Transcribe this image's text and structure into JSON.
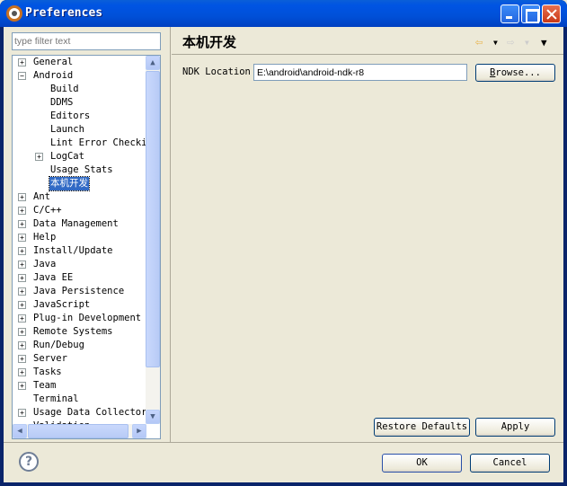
{
  "window": {
    "title": "Preferences"
  },
  "filter": {
    "placeholder": "type filter text"
  },
  "tree": [
    {
      "label": "General",
      "level": 0,
      "expander": "+"
    },
    {
      "label": "Android",
      "level": 0,
      "expander": "-"
    },
    {
      "label": "Build",
      "level": 1,
      "expander": ""
    },
    {
      "label": "DDMS",
      "level": 1,
      "expander": ""
    },
    {
      "label": "Editors",
      "level": 1,
      "expander": ""
    },
    {
      "label": "Launch",
      "level": 1,
      "expander": ""
    },
    {
      "label": "Lint Error Checkir",
      "level": 1,
      "expander": ""
    },
    {
      "label": "LogCat",
      "level": 1,
      "expander": "+"
    },
    {
      "label": "Usage Stats",
      "level": 1,
      "expander": ""
    },
    {
      "label": "本机开发",
      "level": 1,
      "expander": "",
      "selected": true
    },
    {
      "label": "Ant",
      "level": 0,
      "expander": "+"
    },
    {
      "label": "C/C++",
      "level": 0,
      "expander": "+"
    },
    {
      "label": "Data Management",
      "level": 0,
      "expander": "+"
    },
    {
      "label": "Help",
      "level": 0,
      "expander": "+"
    },
    {
      "label": "Install/Update",
      "level": 0,
      "expander": "+"
    },
    {
      "label": "Java",
      "level": 0,
      "expander": "+"
    },
    {
      "label": "Java EE",
      "level": 0,
      "expander": "+"
    },
    {
      "label": "Java Persistence",
      "level": 0,
      "expander": "+"
    },
    {
      "label": "JavaScript",
      "level": 0,
      "expander": "+"
    },
    {
      "label": "Plug-in Development",
      "level": 0,
      "expander": "+"
    },
    {
      "label": "Remote Systems",
      "level": 0,
      "expander": "+"
    },
    {
      "label": "Run/Debug",
      "level": 0,
      "expander": "+"
    },
    {
      "label": "Server",
      "level": 0,
      "expander": "+"
    },
    {
      "label": "Tasks",
      "level": 0,
      "expander": "+"
    },
    {
      "label": "Team",
      "level": 0,
      "expander": "+"
    },
    {
      "label": "Terminal",
      "level": 0,
      "expander": ""
    },
    {
      "label": "Usage Data Collector",
      "level": 0,
      "expander": "+"
    },
    {
      "label": "Validation",
      "level": 0,
      "expander": ""
    }
  ],
  "page": {
    "title": "本机开发",
    "ndk_label": "NDK Location",
    "ndk_value": "E:\\android\\android-ndk-r8",
    "browse_label": "Browse...",
    "restore_label": "Restore Defaults",
    "apply_label": "Apply"
  },
  "footer": {
    "ok_label": "OK",
    "cancel_label": "Cancel"
  }
}
